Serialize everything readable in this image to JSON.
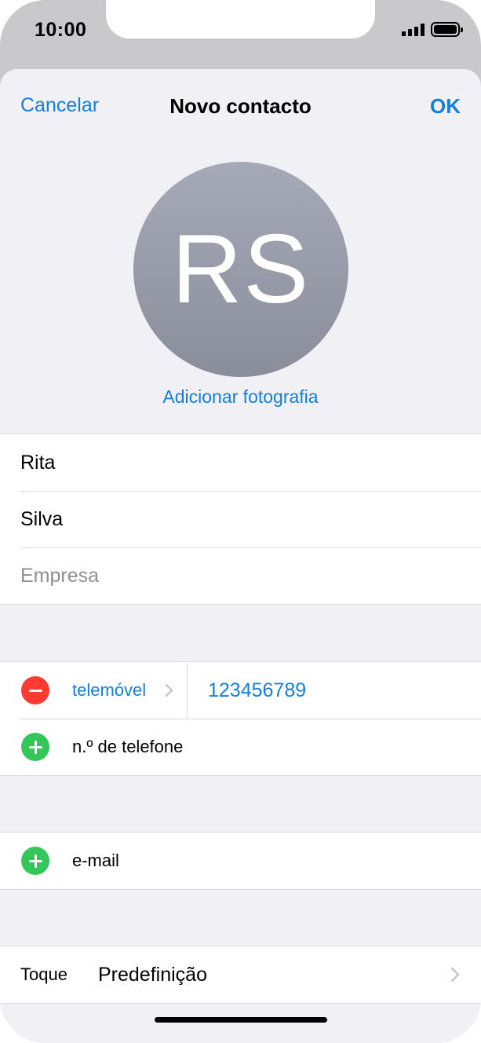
{
  "status_bar": {
    "time": "10:00"
  },
  "nav": {
    "cancel_label": "Cancelar",
    "title": "Novo contacto",
    "ok_label": "OK"
  },
  "avatar": {
    "initials": "RS",
    "add_photo_label": "Adicionar fotografia"
  },
  "name_fields": {
    "first_name": "Rita",
    "last_name": "Silva",
    "company_placeholder": "Empresa"
  },
  "phone": {
    "type_label": "telemóvel",
    "number": "123456789",
    "add_label": "n.º de telefone"
  },
  "email": {
    "add_label": "e-mail"
  },
  "ringtone": {
    "label": "Toque",
    "value": "Predefinição"
  },
  "colors": {
    "accent": "#147fdb",
    "remove_red": "#fd3b30",
    "add_green": "#33c759",
    "grouped_background": "#f0f0f5"
  }
}
